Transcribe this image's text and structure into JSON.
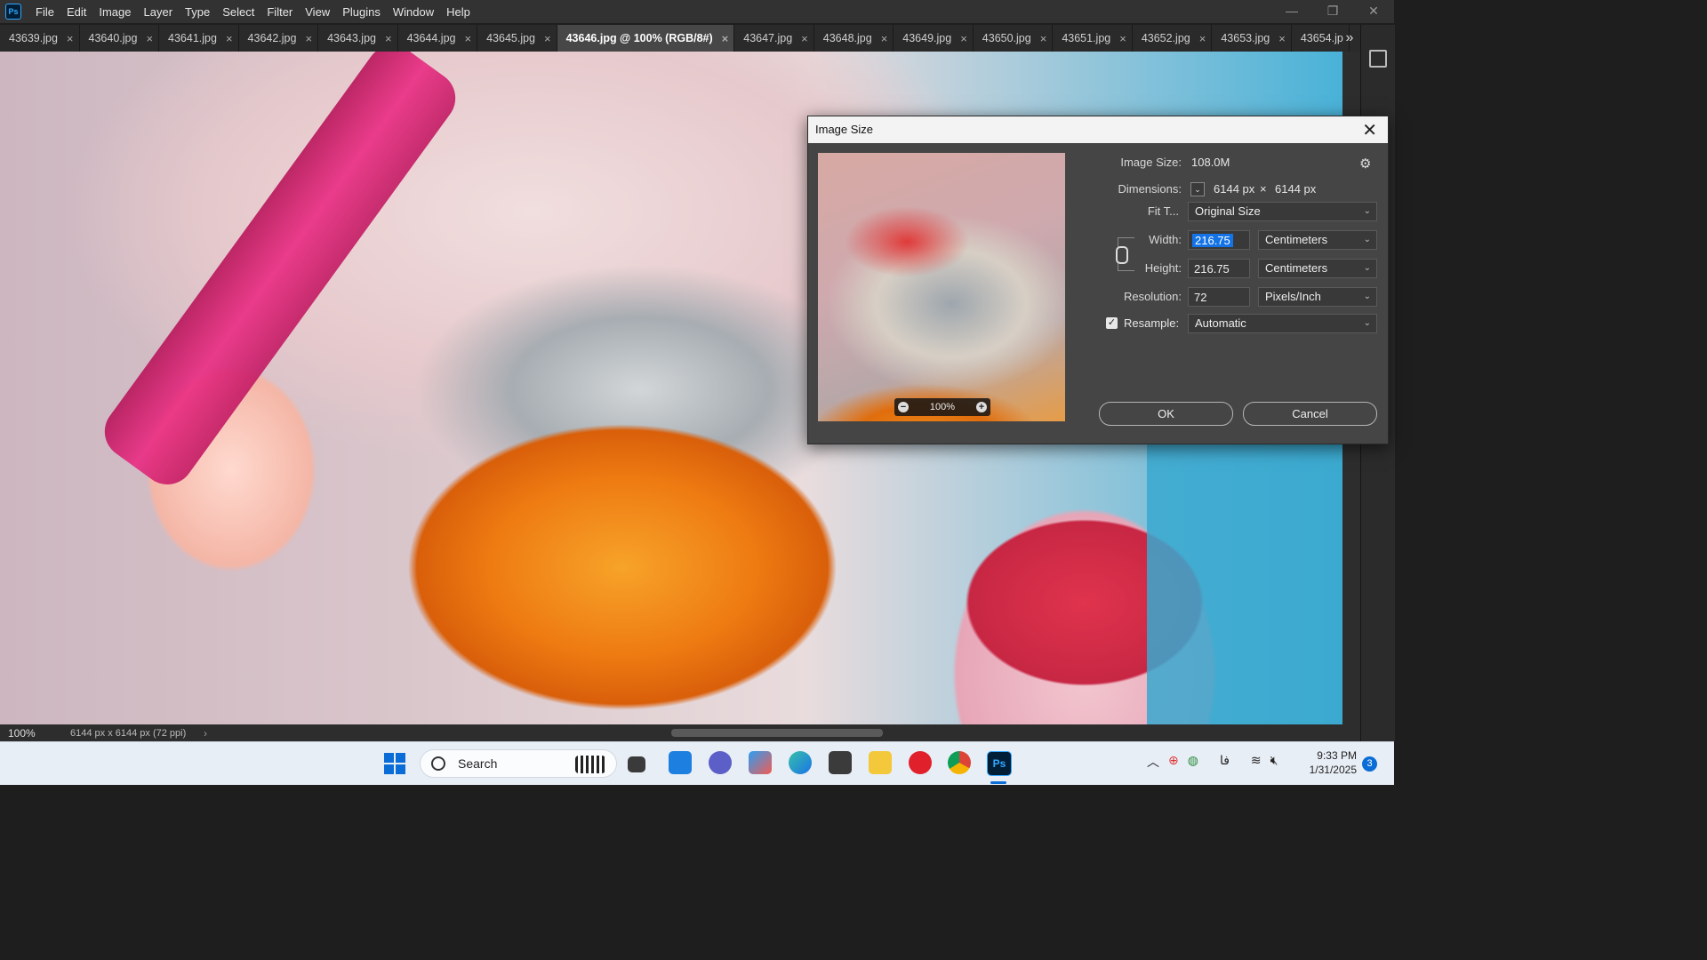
{
  "menubar": {
    "items": [
      "File",
      "Edit",
      "Image",
      "Layer",
      "Type",
      "Select",
      "Filter",
      "View",
      "Plugins",
      "Window",
      "Help"
    ],
    "window_controls": {
      "minimize": "—",
      "restore": "❐",
      "close": "✕"
    }
  },
  "tabs": [
    {
      "label": "43639.jpg",
      "active": false
    },
    {
      "label": "43640.jpg",
      "active": false
    },
    {
      "label": "43641.jpg",
      "active": false
    },
    {
      "label": "43642.jpg",
      "active": false
    },
    {
      "label": "43643.jpg",
      "active": false
    },
    {
      "label": "43644.jpg",
      "active": false
    },
    {
      "label": "43645.jpg",
      "active": false
    },
    {
      "label": "43646.jpg @ 100% (RGB/8#)",
      "active": true
    },
    {
      "label": "43647.jpg",
      "active": false
    },
    {
      "label": "43648.jpg",
      "active": false
    },
    {
      "label": "43649.jpg",
      "active": false
    },
    {
      "label": "43650.jpg",
      "active": false
    },
    {
      "label": "43651.jpg",
      "active": false
    },
    {
      "label": "43652.jpg",
      "active": false
    },
    {
      "label": "43653.jpg",
      "active": false
    },
    {
      "label": "43654.jp",
      "active": false
    }
  ],
  "tab_overflow": "»",
  "status": {
    "zoom": "100%",
    "doc_info": "6144 px x 6144 px (72 ppi)",
    "arrow": "›"
  },
  "dialog": {
    "title": "Image Size",
    "close": "✕",
    "preview_zoom": "100%",
    "image_size_label": "Image Size:",
    "image_size_value": "108.0M",
    "dimensions_label": "Dimensions:",
    "dim_width": "6144 px",
    "dim_times": "×",
    "dim_height": "6144 px",
    "fit_label": "Fit T...",
    "fit_value": "Original Size",
    "width_label": "Width:",
    "width_value": "216.75",
    "width_unit": "Centimeters",
    "height_label": "Height:",
    "height_value": "216.75",
    "height_unit": "Centimeters",
    "resolution_label": "Resolution:",
    "resolution_value": "72",
    "resolution_unit": "Pixels/Inch",
    "resample_label": "Resample:",
    "resample_checked": true,
    "resample_value": "Automatic",
    "ok_label": "OK",
    "cancel_label": "Cancel"
  },
  "taskbar": {
    "search_label": "Search",
    "ps_label": "Ps",
    "tray_lang": "فا",
    "time": "9:33 PM",
    "date": "1/31/2025",
    "notifications": "3"
  },
  "colors": {
    "accent": "#1473e6",
    "ps_blue": "#31a8ff",
    "dialog_bg": "#454545"
  }
}
